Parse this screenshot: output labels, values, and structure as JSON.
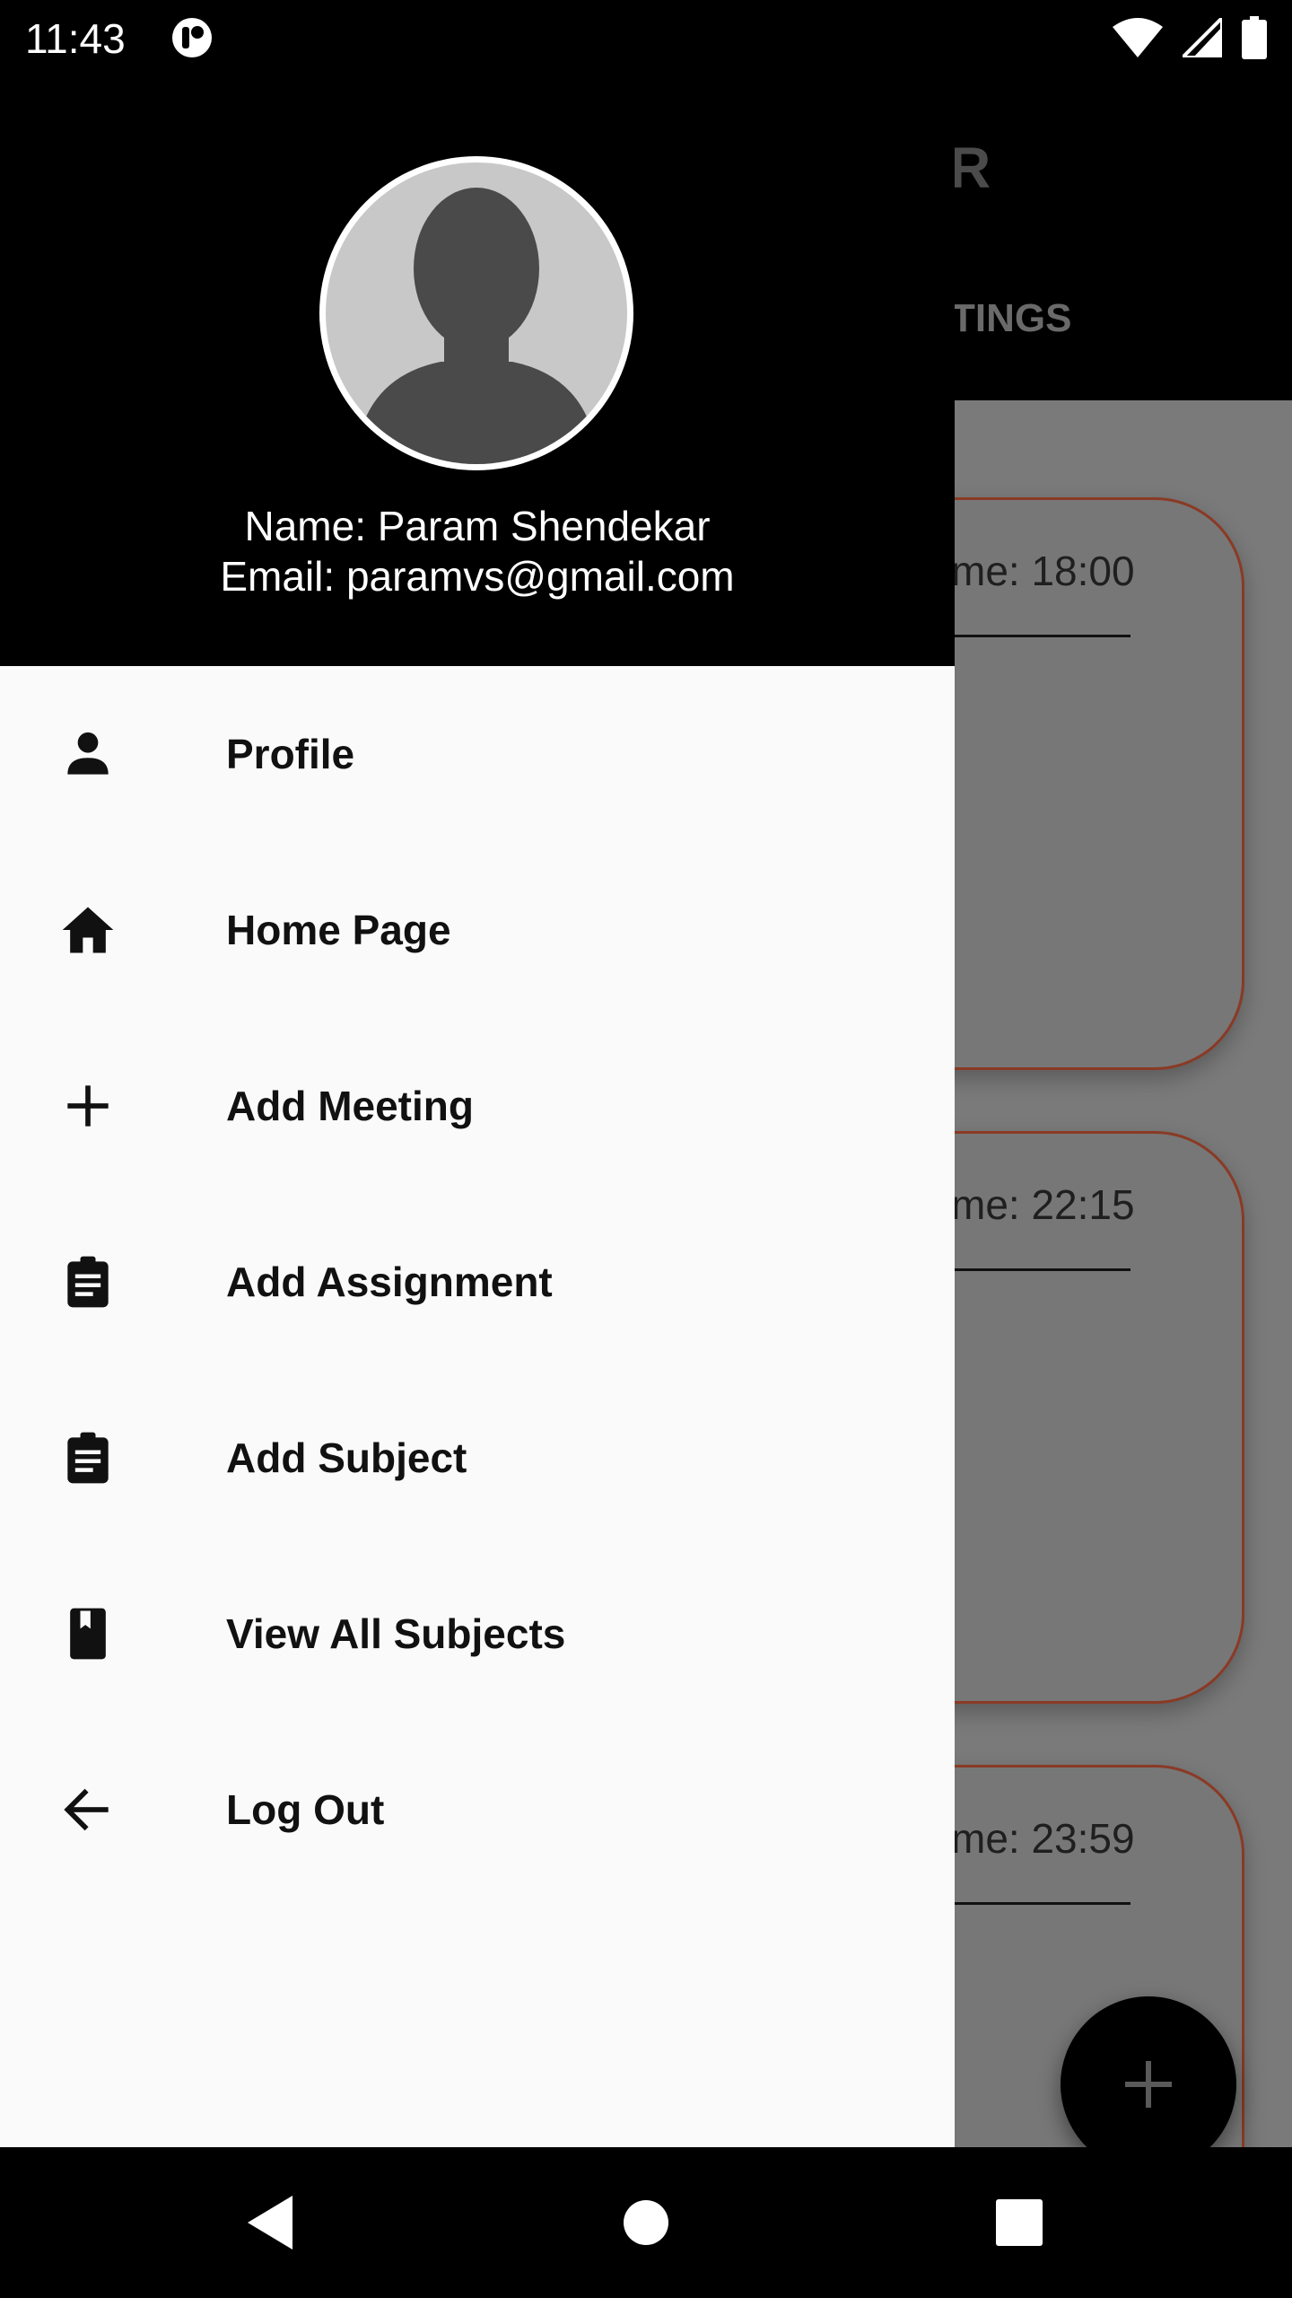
{
  "status_bar": {
    "time": "11:43"
  },
  "background_app": {
    "title_fragment": "R",
    "tab_fragment": "TINGS",
    "cards": [
      {
        "time_text": "me: 18:00"
      },
      {
        "time_text": "me: 22:15"
      },
      {
        "time_text": "me: 23:59"
      }
    ],
    "fab_icon": "add-icon"
  },
  "drawer": {
    "user": {
      "name_line": "Name: Param Shendekar",
      "email_line": "Email: paramvs@gmail.com"
    },
    "items": [
      {
        "label": "Profile",
        "icon": "person-icon"
      },
      {
        "label": "Home Page",
        "icon": "home-icon"
      },
      {
        "label": "Add Meeting",
        "icon": "plus-icon"
      },
      {
        "label": "Add Assignment",
        "icon": "clipboard-icon"
      },
      {
        "label": "Add Subject",
        "icon": "clipboard-icon"
      },
      {
        "label": "View All Subjects",
        "icon": "book-icon"
      },
      {
        "label": "Log Out",
        "icon": "arrow-back-icon"
      }
    ]
  },
  "colors": {
    "header_bg": "#000000",
    "drawer_bg": "#fafafa",
    "card_border": "#8a3a25",
    "scrim": "#7a7a7a"
  }
}
